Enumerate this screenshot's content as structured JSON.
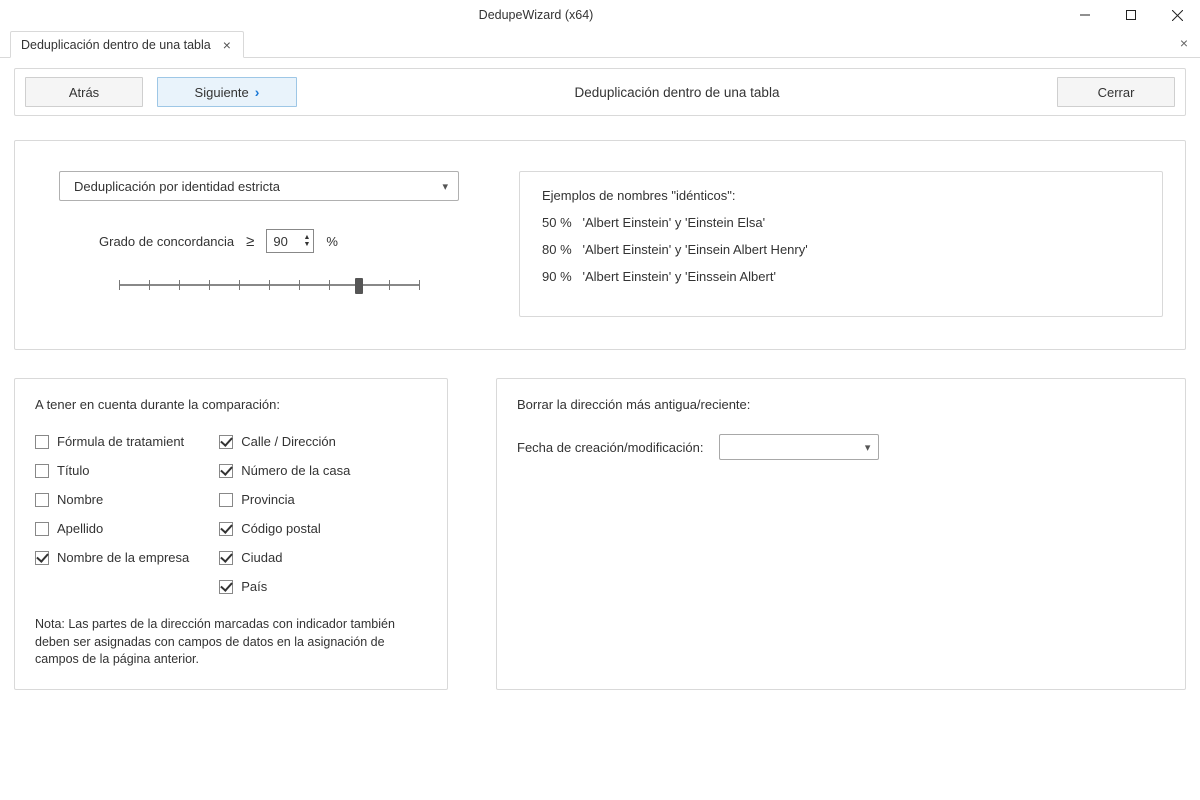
{
  "window": {
    "title": "DedupeWizard  (x64)"
  },
  "tabs": {
    "active_label": "Deduplicación dentro de una tabla"
  },
  "wizard": {
    "back_label": "Atrás",
    "next_label": "Siguiente",
    "close_label": "Cerrar",
    "page_title": "Deduplicación dentro de una tabla"
  },
  "settings": {
    "dropdown_value": "Deduplicación por identidad estricta",
    "agreement_label": "Grado de concordancia",
    "agreement_value": "90",
    "agreement_unit": "%"
  },
  "examples": {
    "heading": "Ejemplos de nombres \"idénticos\":",
    "lines": [
      "50 %   'Albert Einstein' y 'Einstein Elsa'",
      "80 %   'Albert Einstein' y 'Einsein Albert Henry'",
      "90 %   'Albert Einstein' y 'Einssein Albert'"
    ]
  },
  "compare_panel": {
    "title": "A tener en cuenta durante la comparación:",
    "col1": [
      {
        "label": "Fórmula de tratamient",
        "checked": false
      },
      {
        "label": "Título",
        "checked": false
      },
      {
        "label": "Nombre",
        "checked": false
      },
      {
        "label": "Apellido",
        "checked": false
      },
      {
        "label": "Nombre de la empresa",
        "checked": true
      }
    ],
    "col2": [
      {
        "label": "Calle / Dirección",
        "checked": true
      },
      {
        "label": "Número de la casa",
        "checked": true
      },
      {
        "label": "Provincia",
        "checked": false
      },
      {
        "label": "Código postal",
        "checked": true
      },
      {
        "label": "Ciudad",
        "checked": true
      },
      {
        "label": "País",
        "checked": true
      }
    ],
    "note": "Nota: Las partes de la dirección marcadas con indicador también deben ser asignadas con campos de datos en la asignación de campos de la página anterior."
  },
  "delete_panel": {
    "title": "Borrar la dirección más antigua/reciente:",
    "date_label": "Fecha de creación/modificación:",
    "date_value": ""
  }
}
